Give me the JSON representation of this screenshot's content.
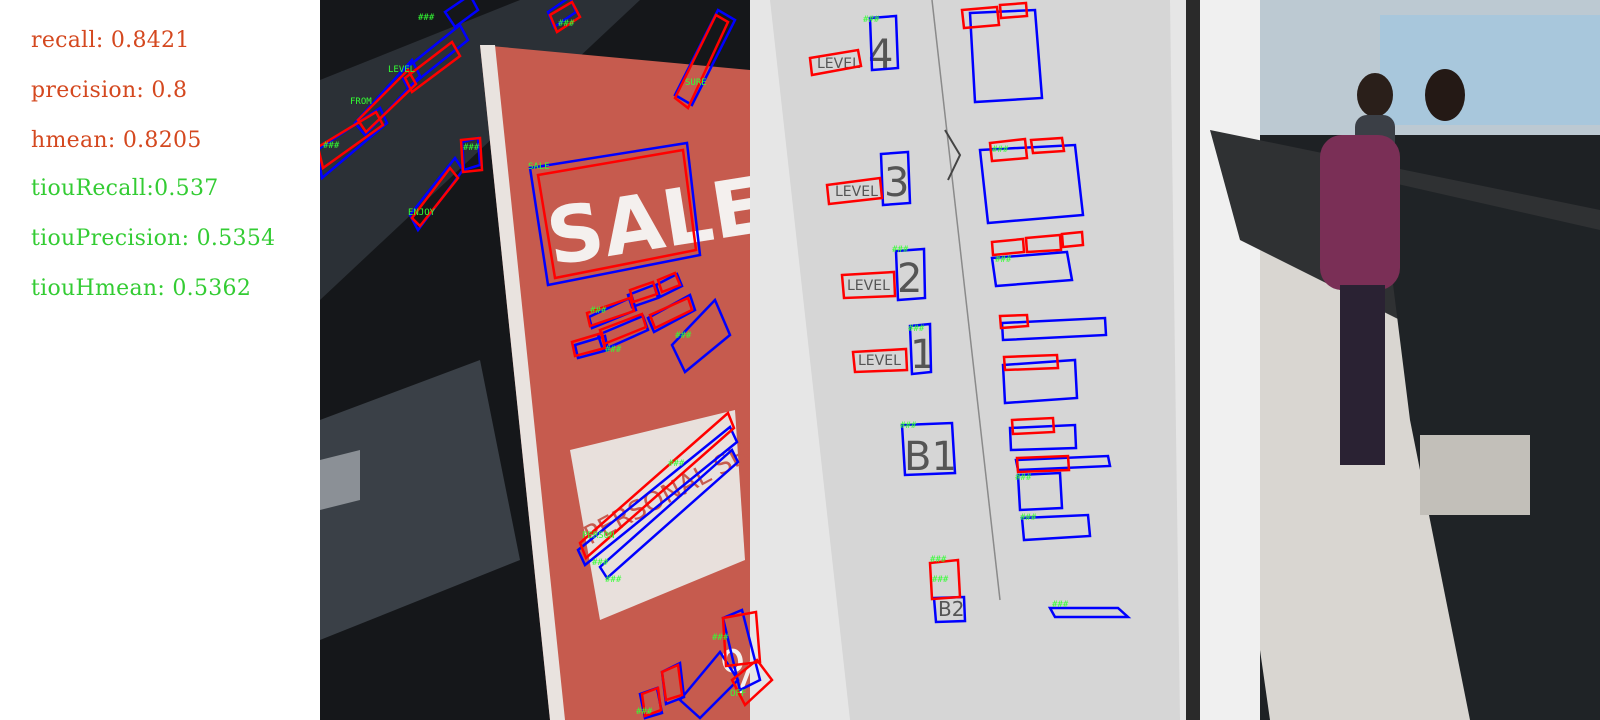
{
  "metrics": {
    "recall": "recall: 0.8421",
    "precision": "precision: 0.8",
    "hmean": "hmean: 0.8205",
    "tiou_recall": "tiouRecall:0.537",
    "tiou_precision": "tiouPrecision: 0.5354",
    "tiou_hmean": "tiouHmean: 0.5362"
  },
  "colors": {
    "metric_standard": "#d4481f",
    "metric_tiou": "#33cc33",
    "gt_box": "#0000ff",
    "det_box": "#ff0000",
    "box_label": "#33ff33"
  },
  "scene_text": {
    "sale": "SALE",
    "personal_shopping": "PERSONAL SHOPPING",
    "level": "LEVEL",
    "level_4": "4",
    "level_3": "3",
    "level_2": "2",
    "level_1": "1",
    "b1": "B1",
    "b2": "B2",
    "percent": "%"
  },
  "box_labels": [
    "###",
    "LEVEL",
    "FROM",
    "SURE",
    "SALE",
    "ENJOY",
    "PERSON",
    "OFF"
  ]
}
